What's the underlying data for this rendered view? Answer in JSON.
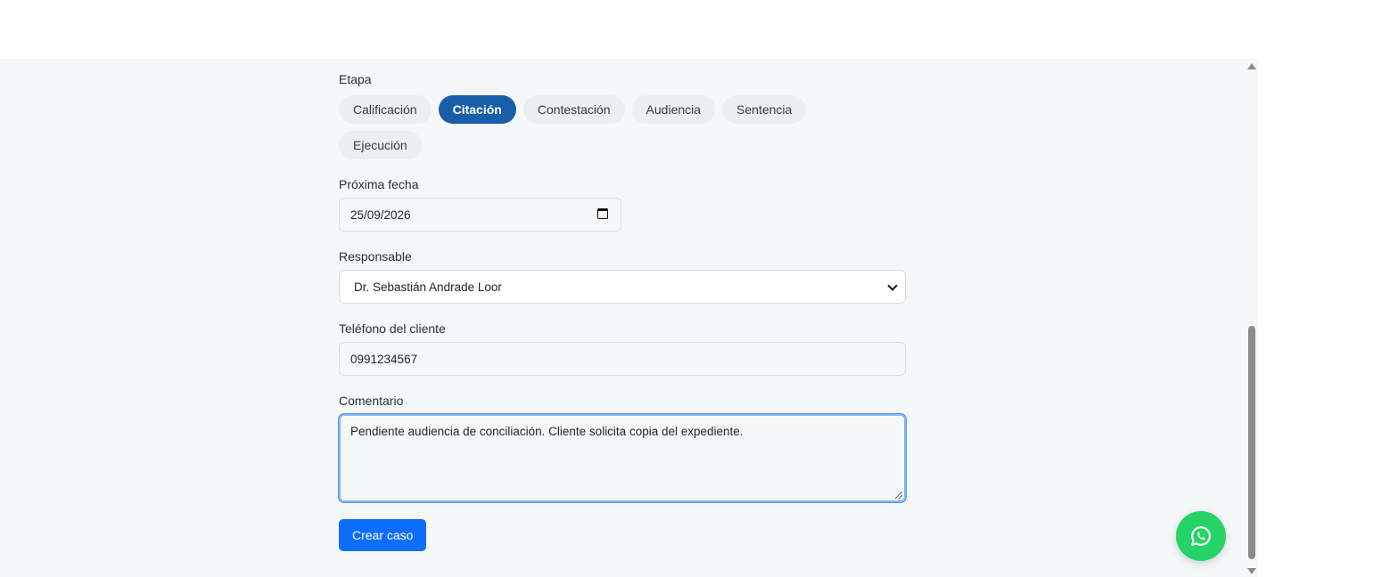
{
  "form": {
    "stage": {
      "label": "Etapa",
      "options": [
        "Calificación",
        "Citación",
        "Contestación",
        "Audiencia",
        "Sentencia",
        "Ejecución"
      ],
      "selected": "Citación"
    },
    "next_date": {
      "label": "Próxima fecha",
      "value": "25/09/2026"
    },
    "responsible": {
      "label": "Responsable",
      "value": "Dr. Sebastián Andrade Loor"
    },
    "client_phone": {
      "label": "Teléfono del cliente",
      "value": "0991234567"
    },
    "comment": {
      "label": "Comentario",
      "value": "Pendiente audiencia de conciliación. Cliente solicita copia del expediente."
    },
    "submit_label": "Crear caso"
  },
  "icons": {
    "calendar": "calendar-icon",
    "dropdown": "chevron-down-icon",
    "floating_action": "whatsapp-icon"
  },
  "colors": {
    "accent": "#0d6efd",
    "chip_active": "#195ea8",
    "whatsapp": "#25d366"
  }
}
